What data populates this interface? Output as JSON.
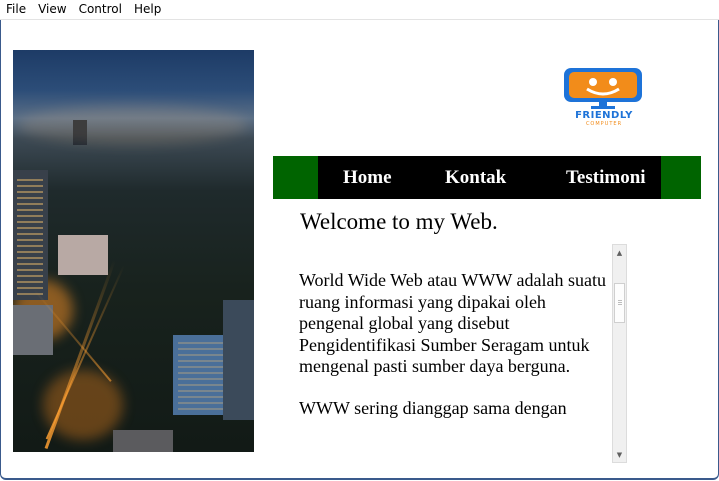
{
  "menubar": {
    "items": [
      {
        "label": "File"
      },
      {
        "label": "View"
      },
      {
        "label": "Control"
      },
      {
        "label": "Help"
      }
    ]
  },
  "logo": {
    "text": "FRIENDLY",
    "subtext": "COMPUTER",
    "colors": {
      "monitor": "#1e73d8",
      "accent": "#f28c1a"
    }
  },
  "nav": {
    "colors": {
      "bar": "#006400",
      "inner": "#000000",
      "text": "#ffffff"
    },
    "links": [
      {
        "label": "Home"
      },
      {
        "label": "Kontak"
      },
      {
        "label": "Testimoni"
      }
    ]
  },
  "main": {
    "welcome": "Welcome to my Web.",
    "paragraphs": [
      "World Wide Web atau WWW adalah suatu ruang informasi yang dipakai oleh pengenal global yang disebut Pengidentifikasi Sumber Seragam untuk mengenal pasti sumber daya berguna.",
      "WWW sering dianggap sama dengan"
    ]
  },
  "scrollbar": {
    "up_icon": "arrow-up-icon",
    "down_icon": "arrow-down-icon"
  }
}
